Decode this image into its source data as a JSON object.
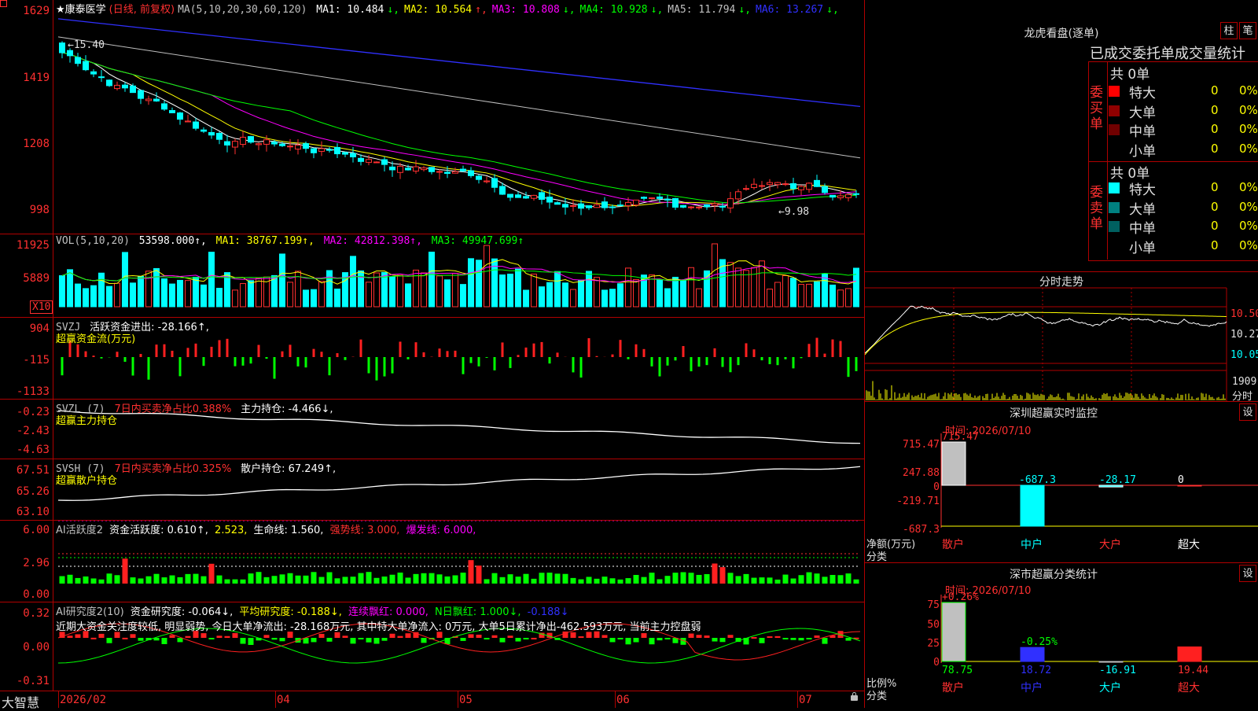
{
  "app": {
    "name": "大智慧",
    "lock_icon": "lock-icon"
  },
  "kline": {
    "title": "★康泰医学",
    "mode": "(日线, 前复权)",
    "ma_params": "MA(5,10,20,30,60,120)",
    "ma": [
      {
        "label": "MA1: 10.484",
        "arrow": "↓",
        "color": "#ffffff"
      },
      {
        "label": "MA2: 10.564",
        "arrow": "↑",
        "color": "#ffff00"
      },
      {
        "label": "MA3: 10.808",
        "arrow": "↓",
        "color": "#ff00ff"
      },
      {
        "label": "MA4: 10.928",
        "arrow": "↓",
        "color": "#00ff00"
      },
      {
        "label": "MA5: 11.794",
        "arrow": "↓",
        "color": "#c0c0c0"
      },
      {
        "label": "MA6: 13.267",
        "arrow": "↓",
        "color": "#3030ff"
      }
    ],
    "y_labels": [
      "1629",
      "1419",
      "1208",
      "998"
    ],
    "high_note": "←15.40",
    "low_note": "←9.98"
  },
  "vol": {
    "title": "VOL(5,10,20)",
    "value": "53598.000↑,",
    "ma1": "MA1: 38767.199↑,",
    "ma2": "MA2: 42812.398↑,",
    "ma3": "MA3: 49947.699↑",
    "y_labels": [
      "11925",
      "5889"
    ],
    "unit": "X10"
  },
  "svzj": {
    "title": "SVZJ",
    "active": "活跃资金进出: -28.166↑,",
    "subtitle": "超赢资金流(万元)",
    "y_labels": [
      "904",
      "-115",
      "-1133"
    ]
  },
  "svzl": {
    "title": "SVZL (7)",
    "ratio": "7日内买卖净占比0.388%",
    "holding": "主力持仓: -4.466↓,",
    "subtitle": "超赢主力持仓",
    "y_labels": [
      "-0.23",
      "-2.43",
      "-4.63"
    ]
  },
  "svsh": {
    "title": "SVSH (7)",
    "ratio": "7日内买卖净占比0.325%",
    "holding": "散户持仓: 67.249↑,",
    "subtitle": "超赢散户持仓",
    "y_labels": [
      "67.51",
      "65.26",
      "63.10"
    ]
  },
  "ai_active": {
    "title": "AI活跃度2",
    "activity": "资金活跃度: 0.610↑,",
    "v2": "2.523,",
    "life": "生命线: 1.560,",
    "strong": "强势线: 3.000,",
    "burst": "爆发线: 6.000,",
    "y_labels": [
      "6.00",
      "2.96",
      "0.00"
    ]
  },
  "ai_research": {
    "title": "AI研究度2(10)",
    "research": "资金研究度: -0.064↓,",
    "avg": "平均研究度: -0.188↓,",
    "red": "连续飘红: 0.000,",
    "n_red": "N日飘红: 1.000↓,",
    "v5": "-0.188↓",
    "comment": "近期大资金关注度较低, 明显弱势, 今日大单净流出: -28.168万元, 其中特大单净流入: 0万元, 大单5日累计净出-462.593万元, 当前主力控盘弱",
    "y_labels": [
      "0.32",
      "0.00",
      "-0.31"
    ]
  },
  "x_axis": [
    "2026/02",
    "04",
    "05",
    "06",
    "07"
  ],
  "dragon": {
    "title": "龙虎看盘(逐单)",
    "btn_bar": "柱",
    "btn_pen": "笔",
    "subtitle": "已成交委托单成交量统计",
    "buy_label": "委买单",
    "sell_label": "委卖单",
    "buy_total": "共 0单",
    "sell_total": "共 0单",
    "buy_rows": [
      {
        "name": "特大",
        "count": "0",
        "pct": "0%",
        "color": "#ff0000"
      },
      {
        "name": "大单",
        "count": "0",
        "pct": "0%",
        "color": "#900000"
      },
      {
        "name": "中单",
        "count": "0",
        "pct": "0%",
        "color": "#700000"
      },
      {
        "name": "小单",
        "count": "0",
        "pct": "0%",
        "color": "#000000"
      }
    ],
    "sell_rows": [
      {
        "name": "特大",
        "count": "0",
        "pct": "0%",
        "color": "#00ffff"
      },
      {
        "name": "大单",
        "count": "0",
        "pct": "0%",
        "color": "#008080"
      },
      {
        "name": "中单",
        "count": "0",
        "pct": "0%",
        "color": "#006060"
      },
      {
        "name": "小单",
        "count": "0",
        "pct": "0%",
        "color": "#000000"
      }
    ]
  },
  "intraday": {
    "title": "分时走势",
    "y_labels": [
      "10.50",
      "10.27",
      "10.05"
    ],
    "vol_label": "1909",
    "vol_unit": "分时"
  },
  "monitor": {
    "title": "深圳超赢实时监控",
    "btn": "设",
    "time": "时间: 2026/07/10",
    "y_labels": [
      "715.47",
      "247.88",
      "0",
      "-219.71",
      "-687.3"
    ],
    "unit": "净额(万元)",
    "cat_label": "分类",
    "bars": [
      {
        "name": "散户",
        "value": 715.47,
        "label": "715.47"
      },
      {
        "name": "中户",
        "value": -687.3,
        "label": "-687.3"
      },
      {
        "name": "大户",
        "value": -28.17,
        "label": "-28.17"
      },
      {
        "name": "超大",
        "value": 0,
        "label": "0"
      }
    ]
  },
  "classify": {
    "title": "深市超赢分类统计",
    "btn": "设",
    "time": "时间: 2026/07/10",
    "y_labels": [
      "75",
      "50",
      "25",
      "0"
    ],
    "unit": "比例%",
    "cat_label": "分类",
    "bars": [
      {
        "name": "散户",
        "value": 78.75,
        "label": "78.75",
        "top": "+0.26%"
      },
      {
        "name": "中户",
        "value": 18.72,
        "label": "18.72",
        "top": "-0.25%"
      },
      {
        "name": "大户",
        "value": -16.91,
        "label": "-16.91",
        "top": ""
      },
      {
        "name": "超大",
        "value": 19.44,
        "label": "19.44",
        "top": ""
      }
    ]
  }
}
